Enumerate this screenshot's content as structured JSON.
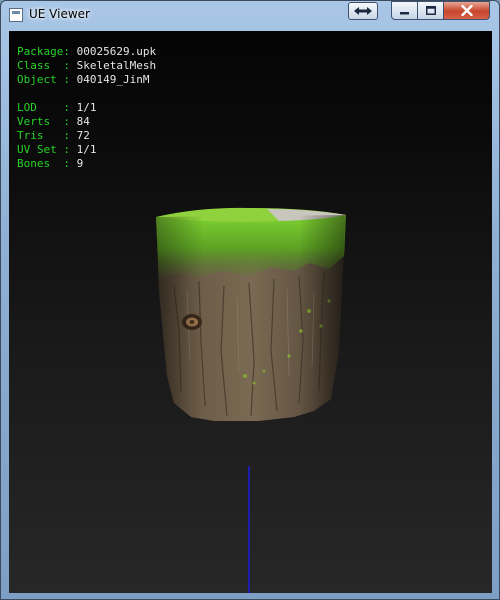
{
  "window": {
    "title": "UE Viewer"
  },
  "info": {
    "package": {
      "label": "Package:",
      "value": "00025629.upk"
    },
    "class": {
      "label": "Class  :",
      "value": "SkeletalMesh"
    },
    "object": {
      "label": "Object :",
      "value": "040149_JinM"
    },
    "lod": {
      "label": "LOD    :",
      "value": "1/1"
    },
    "verts": {
      "label": "Verts  :",
      "value": "84"
    },
    "tris": {
      "label": "Tris   :",
      "value": "72"
    },
    "uvset": {
      "label": "UV Set :",
      "value": "1/1"
    },
    "bones": {
      "label": "Bones  :",
      "value": "9"
    }
  },
  "colors": {
    "label": "#27d327",
    "value": "#e6e6e6",
    "axis": "#1a1adc",
    "grass": "#6fbf2a",
    "bark": "#6b5a45"
  },
  "icons": [
    "app-icon",
    "swap-icon",
    "minimize-icon",
    "maximize-icon",
    "close-icon"
  ]
}
